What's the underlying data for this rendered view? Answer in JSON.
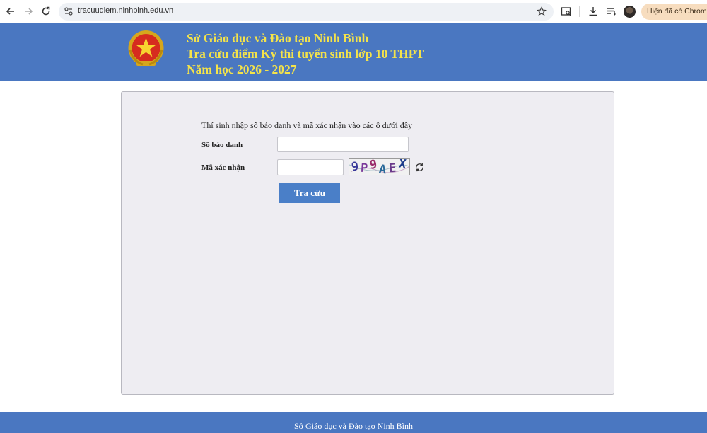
{
  "browser": {
    "url": "tracuudiem.ninhbinh.edu.vn",
    "update_label": "Hiện đã có Chrome"
  },
  "header": {
    "line1": "Sở Giáo dục và Đào tạo Ninh Bình",
    "line2": "Tra cứu điểm Kỳ thi tuyển sinh lớp 10 THPT",
    "line3": "Năm học 2026 - 2027",
    "text_color": "#f4e34a",
    "bg_color": "#4a77c1"
  },
  "form": {
    "instruction": "Thí sinh nhập số báo danh và mã xác nhận vào các ô dưới đây",
    "sbd_label": "Số báo danh",
    "sbd_value": "",
    "captcha_label": "Mã xác nhận",
    "captcha_value": "",
    "captcha_chars": [
      "9",
      "P",
      "9",
      "A",
      "E",
      "X"
    ],
    "submit_label": "Tra cứu"
  },
  "footer": {
    "text": "Sở Giáo dục và Đào tạo Ninh Bình"
  }
}
